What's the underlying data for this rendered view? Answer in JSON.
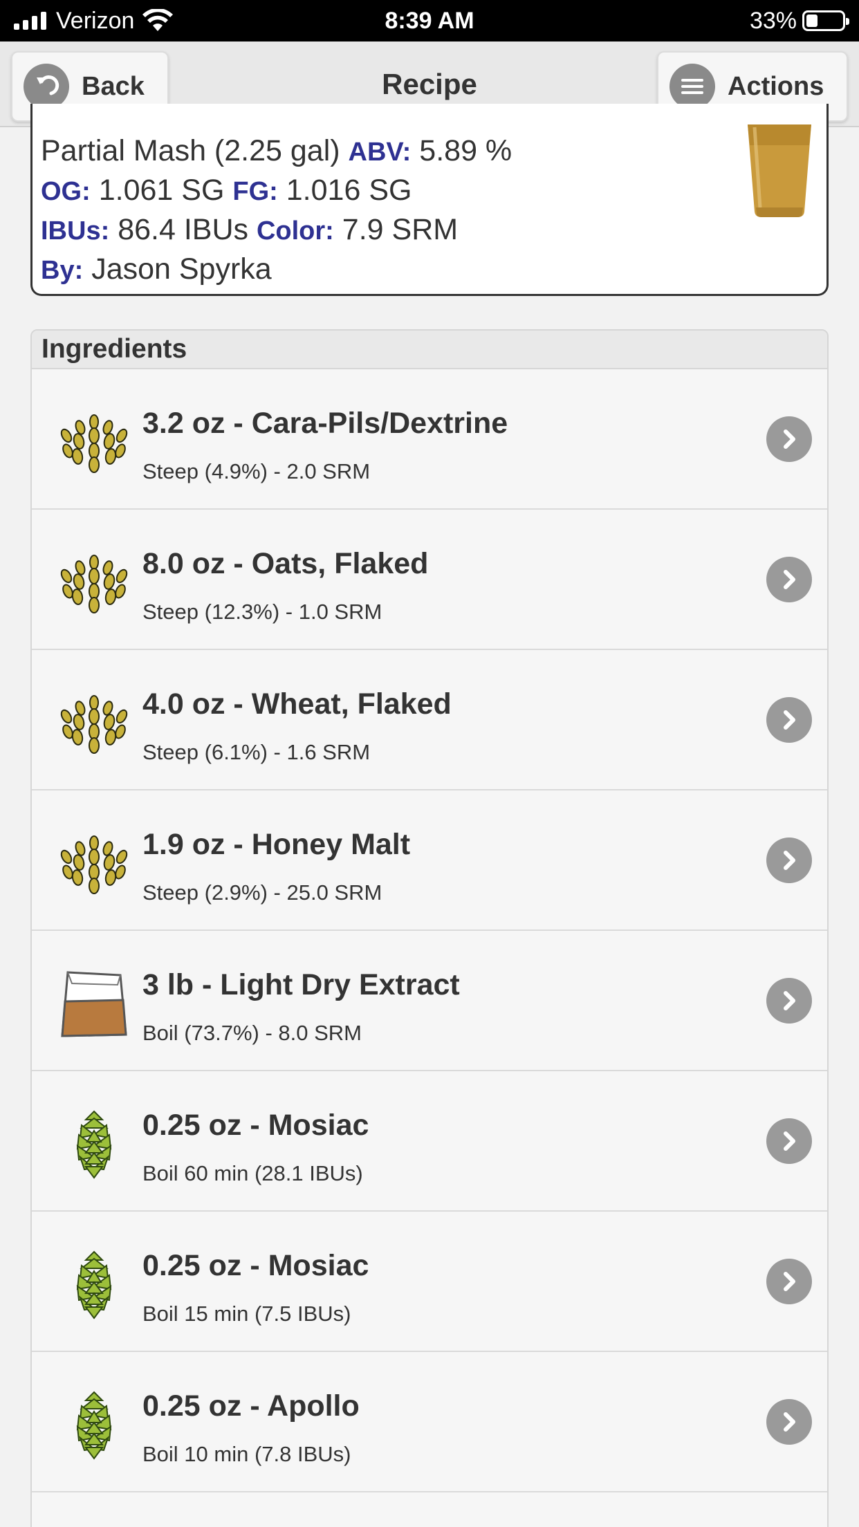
{
  "status_bar": {
    "carrier": "Verizon",
    "time": "8:39 AM",
    "battery": "33%",
    "battery_level": 0.33
  },
  "header": {
    "back_label": "Back",
    "title": "Recipe",
    "actions_label": "Actions"
  },
  "summary": {
    "batch": "Partial Mash (2.25 gal)",
    "abv_label": "ABV:",
    "abv": "5.89 %",
    "og_label": "OG:",
    "og": "1.061 SG",
    "fg_label": "FG:",
    "fg": "1.016 SG",
    "ibu_label": "IBUs:",
    "ibu": "86.4 IBUs",
    "color_label": "Color:",
    "color": "7.9 SRM",
    "by_label": "By:",
    "author": "Jason Spyrka"
  },
  "ingredients": {
    "header": "Ingredients",
    "items": [
      {
        "icon": "grain-icon",
        "name": "3.2 oz - Cara-Pils/Dextrine",
        "detail": "Steep (4.9%) - 2.0 SRM"
      },
      {
        "icon": "grain-icon",
        "name": "8.0 oz - Oats, Flaked",
        "detail": "Steep (12.3%) - 1.0 SRM"
      },
      {
        "icon": "grain-icon",
        "name": "4.0 oz - Wheat, Flaked",
        "detail": "Steep (6.1%) - 1.6 SRM"
      },
      {
        "icon": "grain-icon",
        "name": "1.9 oz - Honey Malt",
        "detail": "Steep (2.9%) - 25.0 SRM"
      },
      {
        "icon": "extract-bag-icon",
        "name": "3 lb - Light Dry Extract",
        "detail": "Boil (73.7%) - 8.0 SRM"
      },
      {
        "icon": "hop-icon",
        "name": "0.25 oz - Mosiac",
        "detail": "Boil 60 min (28.1 IBUs)"
      },
      {
        "icon": "hop-icon",
        "name": "0.25 oz - Mosiac",
        "detail": "Boil 15 min (7.5 IBUs)"
      },
      {
        "icon": "hop-icon",
        "name": "0.25 oz - Apollo",
        "detail": "Boil 10 min (7.8 IBUs)"
      }
    ]
  },
  "colors": {
    "label_blue": "#2e3192",
    "beer": "#b8892e",
    "button_gray": "#9a9a9a"
  }
}
